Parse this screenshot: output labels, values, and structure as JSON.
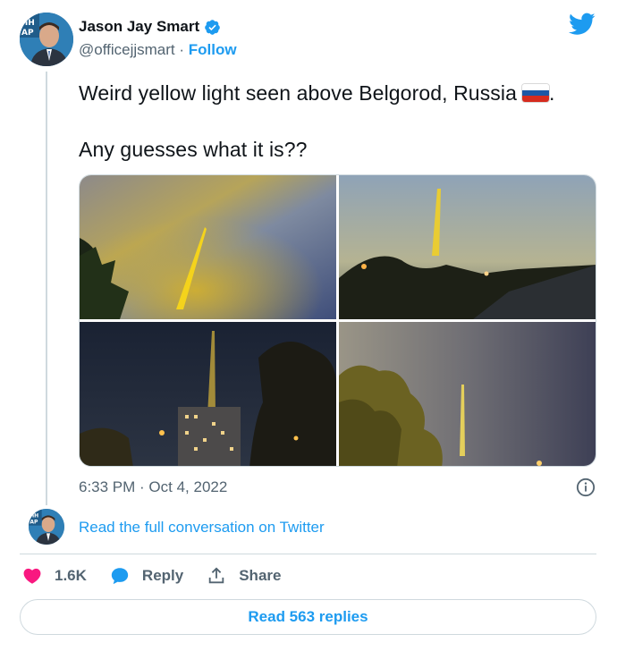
{
  "author": {
    "name": "Jason Jay Smart",
    "handle": "@officejjsmart",
    "separator": "·",
    "follow_label": "Follow"
  },
  "tweet": {
    "line1": "Weird yellow light seen above Belgorod, Russia",
    "line1_suffix": ".",
    "line2": "Any guesses what it is??",
    "flag_emoji": "russia-flag"
  },
  "timestamp": "6:33 PM · Oct 4, 2022",
  "read_conversation": "Read the full conversation on Twitter",
  "actions": {
    "likes": "1.6K",
    "reply_label": "Reply",
    "share_label": "Share"
  },
  "read_replies": "Read 563 replies",
  "colors": {
    "accent": "#1d9bf0",
    "like": "#f91880",
    "text": "#0f1419",
    "muted": "#536471",
    "border": "#cfd9de"
  },
  "icons": [
    "verified-badge-icon",
    "twitter-bird-icon",
    "info-icon",
    "heart-icon",
    "reply-bubble-icon",
    "share-icon"
  ]
}
